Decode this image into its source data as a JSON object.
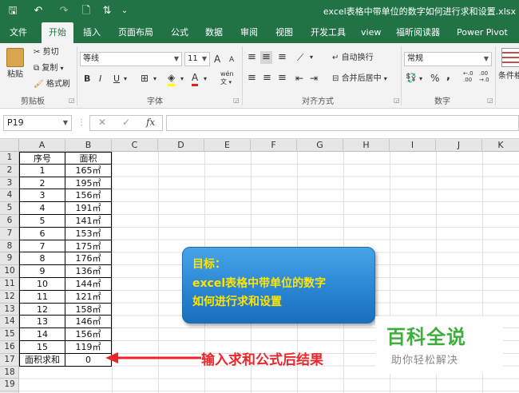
{
  "titlebar": {
    "title": "excel表格中带单位的数字如何进行求和设置.xlsx",
    "quick_access": {
      "save": "🖫",
      "undo": "↶",
      "redo": "↷",
      "preview": "🗋",
      "sort": "⇅",
      "more": "⌄"
    }
  },
  "tabs": [
    "文件",
    "开始",
    "插入",
    "页面布局",
    "公式",
    "数据",
    "审阅",
    "视图",
    "开发工具",
    "view",
    "福昕阅读器",
    "Power Pivot"
  ],
  "ribbon": {
    "clipboard": {
      "paste": "粘贴",
      "cut": "剪切",
      "copy": "复制",
      "format_painter": "格式刷",
      "label": "剪贴板"
    },
    "font": {
      "name": "等线",
      "size": "11",
      "bold": "B",
      "italic": "I",
      "underline": "U",
      "grow": "A",
      "shrink": "A",
      "label": "字体",
      "phonetic": "wén"
    },
    "alignment": {
      "wrap": "自动换行",
      "merge": "合并后居中",
      "label": "对齐方式"
    },
    "number": {
      "format": "常规",
      "percent": "%",
      "comma": ",",
      "label": "数字"
    },
    "styles": {
      "cond": "条件格"
    }
  },
  "formula_bar": {
    "name_box": "P19",
    "cancel": "✕",
    "enter": "✓",
    "fx": "fx",
    "value": ""
  },
  "columns": [
    "A",
    "B",
    "C",
    "D",
    "E",
    "F",
    "G",
    "H",
    "I",
    "J",
    "K"
  ],
  "rows": [
    "1",
    "2",
    "3",
    "4",
    "5",
    "6",
    "7",
    "8",
    "9",
    "10",
    "11",
    "12",
    "13",
    "14",
    "15",
    "16",
    "17",
    "18",
    "19"
  ],
  "table": {
    "headers": [
      "序号",
      "面积"
    ],
    "data": [
      [
        "1",
        "165㎡"
      ],
      [
        "2",
        "195㎡"
      ],
      [
        "3",
        "156㎡"
      ],
      [
        "4",
        "191㎡"
      ],
      [
        "5",
        "141㎡"
      ],
      [
        "6",
        "153㎡"
      ],
      [
        "7",
        "175㎡"
      ],
      [
        "8",
        "176㎡"
      ],
      [
        "9",
        "136㎡"
      ],
      [
        "10",
        "144㎡"
      ],
      [
        "11",
        "121㎡"
      ],
      [
        "12",
        "158㎡"
      ],
      [
        "13",
        "146㎡"
      ],
      [
        "14",
        "156㎡"
      ],
      [
        "15",
        "119㎡"
      ]
    ],
    "total": [
      "面积求和",
      "0"
    ]
  },
  "callout": {
    "line1": "目标：",
    "line2": "excel表格中带单位的数字",
    "line3": "如何进行求和设置"
  },
  "annotation": "输入求和公式后结果",
  "watermark": {
    "main": "百科全说",
    "sub": "助你轻松解决"
  },
  "colors": {
    "excel_green": "#217346",
    "callout_blue": "#2a86d2",
    "callout_text": "#ffe400",
    "annotation_red": "#e8262b",
    "watermark_green": "#3dae3d"
  }
}
